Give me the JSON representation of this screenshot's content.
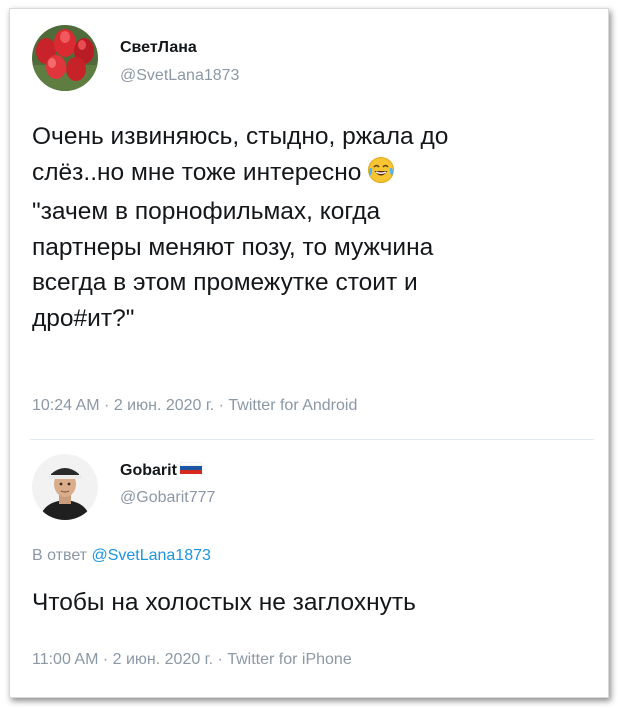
{
  "tweet1": {
    "display_name": "СветЛана",
    "handle": "@SvetLana1873",
    "lines": [
      "Очень извиняюсь, стыдно, ржала до",
      "слёз..но мне тоже интересно",
      "\"зачем в порнофильмах, когда",
      "партнеры меняют позу, то мужчина",
      "всегда в этом промежутке стоит и",
      "дро#ит?\""
    ],
    "emoji": "tears-of-joy",
    "meta": "10:24 AM · 2 июн. 2020 г. · Twitter for Android"
  },
  "tweet2": {
    "display_name": "Gobarit",
    "flag": "russia",
    "handle": "@Gobarit777",
    "reply_prefix": "В ответ ",
    "reply_handle": "@SvetLana1873",
    "text": "Чтобы на холостых не заглохнуть",
    "meta": "11:00 AM · 2 июн. 2020 г. · Twitter for iPhone"
  },
  "colors": {
    "text": "#14171a",
    "secondary": "#8b98a5",
    "link": "#1b95e0",
    "divider": "#e1e8ed"
  }
}
